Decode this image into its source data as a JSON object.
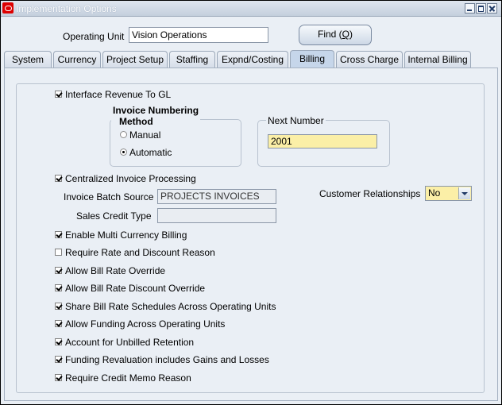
{
  "window": {
    "title": "Implementation Options"
  },
  "header": {
    "operating_unit_label": "Operating Unit",
    "operating_unit_value": "Vision Operations",
    "find_label": "Find (",
    "find_mnemonic": "Q",
    "find_close": ")"
  },
  "tabs": [
    {
      "label": "System"
    },
    {
      "label": "Currency"
    },
    {
      "label": "Project Setup"
    },
    {
      "label": "Staffing"
    },
    {
      "label": "Expnd/Costing"
    },
    {
      "label": "Billing"
    },
    {
      "label": "Cross Charge"
    },
    {
      "label": "Internal Billing"
    }
  ],
  "billing": {
    "interface_revenue": {
      "label": "Interface Revenue To GL",
      "checked": true
    },
    "invoice_numbering": {
      "title_line1": "Invoice Numbering",
      "title_line2": "Method",
      "options": [
        {
          "label": "Manual",
          "selected": false
        },
        {
          "label": "Automatic",
          "selected": true
        }
      ]
    },
    "next_number": {
      "title": "Next Number",
      "value": "2001"
    },
    "centralized": {
      "label": "Centralized Invoice Processing",
      "checked": true
    },
    "invoice_batch_source": {
      "label": "Invoice Batch Source",
      "value": "PROJECTS INVOICES"
    },
    "sales_credit_type": {
      "label": "Sales Credit Type",
      "value": ""
    },
    "customer_relationships": {
      "label": "Customer Relationships",
      "value": "No"
    },
    "checkboxes": [
      {
        "label": "Enable Multi Currency Billing",
        "checked": true
      },
      {
        "label": "Require Rate and Discount Reason",
        "checked": false
      },
      {
        "label": "Allow Bill Rate Override",
        "checked": true
      },
      {
        "label": "Allow Bill Rate Discount Override",
        "checked": true
      },
      {
        "label": "Share Bill Rate Schedules Across Operating Units",
        "checked": true
      },
      {
        "label": "Allow Funding Across Operating Units",
        "checked": true
      },
      {
        "label": "Account for Unbilled Retention",
        "checked": true
      },
      {
        "label": "Funding Revaluation includes Gains and Losses",
        "checked": true
      },
      {
        "label": "Require Credit Memo Reason",
        "checked": true
      }
    ]
  }
}
